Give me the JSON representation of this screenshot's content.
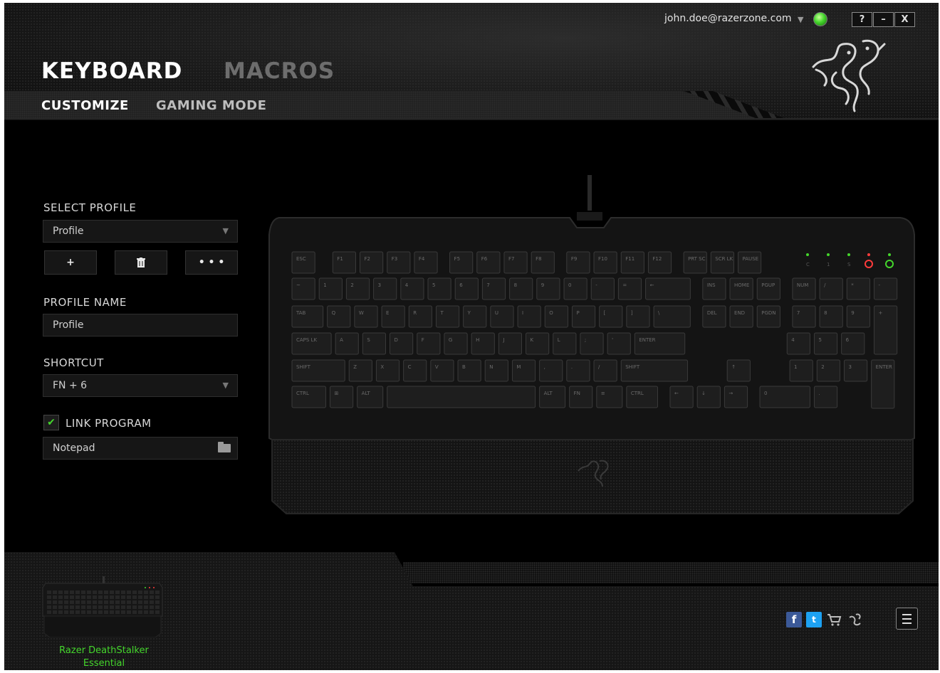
{
  "account": {
    "email": "john.doe@razerzone.com"
  },
  "window_controls": {
    "help": "?",
    "minimize": "–",
    "close": "X"
  },
  "tabs": {
    "main": [
      "KEYBOARD",
      "MACROS"
    ],
    "sub": [
      "CUSTOMIZE",
      "GAMING MODE"
    ],
    "active_main": "KEYBOARD",
    "active_sub": "CUSTOMIZE"
  },
  "colors": {
    "accent": "#44d62c",
    "active_tab": "#ffffff",
    "inactive_tab": "#6d6d6d",
    "background": "#000000"
  },
  "sidebar": {
    "select_profile_label": "SELECT PROFILE",
    "profile_select_value": "Profile",
    "profile_buttons": {
      "add": "+",
      "delete": "🗑",
      "more": "• • •"
    },
    "profile_name_label": "PROFILE NAME",
    "profile_name_value": "Profile",
    "shortcut_label": "SHORTCUT",
    "shortcut_value": "FN + 6",
    "link_program_label": "LINK PROGRAM",
    "link_program_checked": true,
    "link_program_value": "Notepad"
  },
  "keyboard": {
    "rows": [
      [
        "ESC",
        "F1",
        "F2",
        "F3",
        "F4",
        "F5",
        "F6",
        "F7",
        "F8",
        "F9",
        "F10",
        "F11",
        "F12",
        "PRT SC",
        "SCR LK",
        "PAUSE"
      ],
      [
        "~",
        "1",
        "2",
        "3",
        "4",
        "5",
        "6",
        "7",
        "8",
        "9",
        "0",
        "-",
        "=",
        "←",
        "INS",
        "HOME",
        "PGUP",
        "NUM",
        "/",
        "*",
        "-"
      ],
      [
        "TAB",
        "Q",
        "W",
        "E",
        "R",
        "T",
        "Y",
        "U",
        "I",
        "O",
        "P",
        "[",
        "]",
        "\\",
        "DEL",
        "END",
        "PGDN",
        "7",
        "8",
        "9",
        "+"
      ],
      [
        "CAPS LK",
        "A",
        "S",
        "D",
        "F",
        "G",
        "H",
        "J",
        "K",
        "L",
        ";",
        "'",
        "ENTER",
        "4",
        "5",
        "6"
      ],
      [
        "SHIFT",
        "Z",
        "X",
        "C",
        "V",
        "B",
        "N",
        "M",
        ",",
        ".",
        "/",
        "SHIFT",
        "↑",
        "1",
        "2",
        "3",
        "ENTER"
      ],
      [
        "CTRL",
        "⊞",
        "ALT",
        "",
        "ALT",
        "FN",
        "≡",
        "CTRL",
        "←",
        "↓",
        "→",
        "0",
        "."
      ]
    ],
    "indicators": {
      "labels": [
        "C",
        "1",
        "S"
      ],
      "red_active": true,
      "power": "on"
    }
  },
  "footer": {
    "device_name_line1": "Razer DeathStalker",
    "device_name_line2": "Essential",
    "social_icons": [
      "facebook-icon",
      "twitter-icon",
      "cart-icon",
      "razer-icon"
    ]
  }
}
